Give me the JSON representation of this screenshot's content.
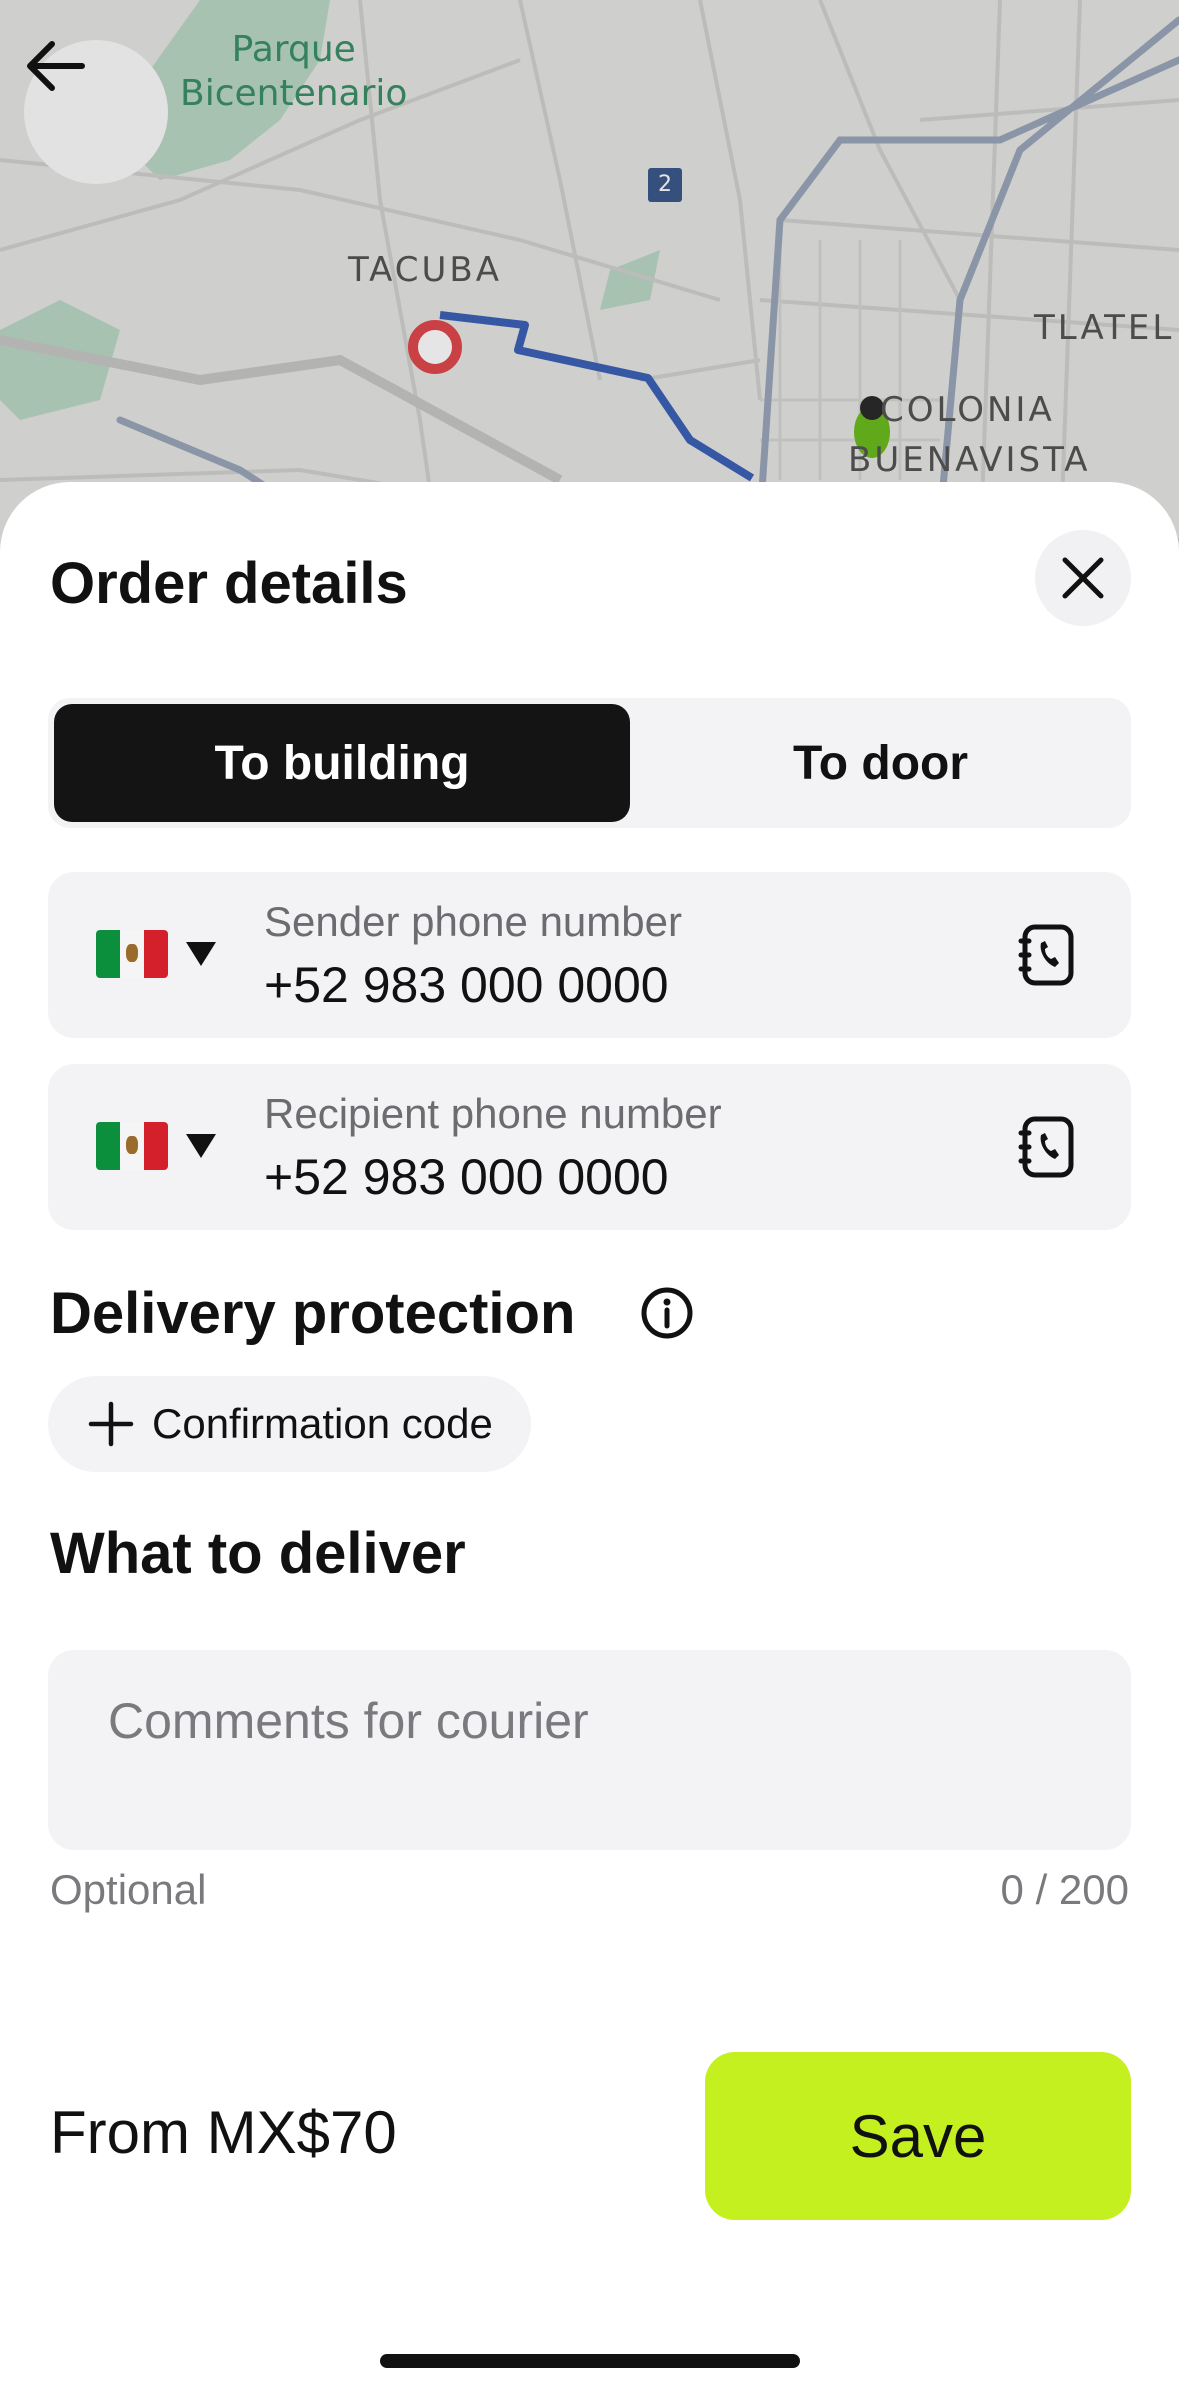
{
  "map": {
    "park_label_line1": "Parque",
    "park_label_line2": "Bicentenario",
    "district_tacuba": "TACUBA",
    "district_tlatelolco": "TLATEL",
    "district_colonia": "COLONIA",
    "district_buenavista": "BUENAVISTA",
    "road_number": "2"
  },
  "sheet": {
    "title": "Order details",
    "segments": [
      {
        "label": "To building",
        "selected": true
      },
      {
        "label": "To door",
        "selected": false
      }
    ],
    "sender": {
      "label": "Sender phone number",
      "value": "+52 983 000 0000",
      "country_icon": "mexico-flag-icon"
    },
    "recipient": {
      "label": "Recipient phone number",
      "value": "+52 983 000 0000",
      "country_icon": "mexico-flag-icon"
    },
    "protection": {
      "title": "Delivery protection",
      "chip_label": "Confirmation code"
    },
    "deliver": {
      "title": "What to deliver",
      "comment_placeholder": "Comments for courier",
      "helper_left": "Optional",
      "counter": "0 / 200"
    }
  },
  "footer": {
    "price": "From MX$70",
    "save_label": "Save"
  },
  "colors": {
    "accent": "#c3f01e",
    "segment_active": "#141414",
    "field_bg": "#f3f3f5",
    "route": "#3d63b7"
  }
}
